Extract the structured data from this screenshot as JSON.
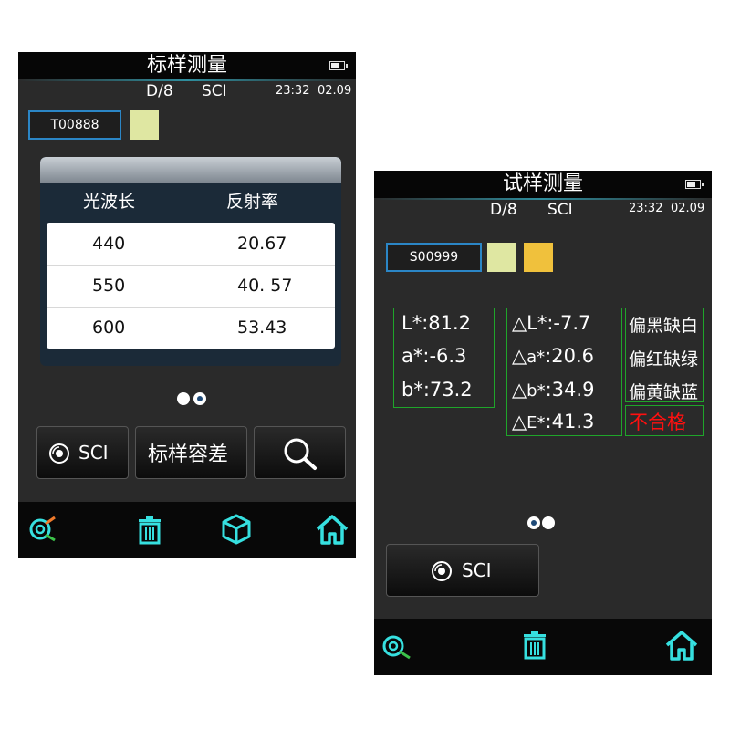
{
  "screen1": {
    "title": "标样测量",
    "geometry": "D/8",
    "mode": "SCI",
    "time": "23:32",
    "date": "02.09",
    "sample_id": "T00888",
    "swatch_color": "#dfe7a2",
    "table": {
      "headers": [
        "光波长",
        "反射率"
      ],
      "rows": [
        {
          "wavelength": "440",
          "reflectance": "20.67"
        },
        {
          "wavelength": "550",
          "reflectance": "40. 57"
        },
        {
          "wavelength": "600",
          "reflectance": "53.43"
        }
      ]
    },
    "buttons": {
      "sci": "SCI",
      "tolerance": "标样容差"
    },
    "icons": [
      "target-icon",
      "trash-icon",
      "cube-icon",
      "home-icon"
    ]
  },
  "screen2": {
    "title": "试样测量",
    "geometry": "D/8",
    "mode": "SCI",
    "time": "23:32",
    "date": "02.09",
    "sample_id": "S00999",
    "swatch_colors": [
      "#dfe7a2",
      "#f0c13c"
    ],
    "lab": [
      "L*:81.2",
      "a*:-6.3",
      "b*:73.2"
    ],
    "delta": {
      "dL": {
        "sym": "△",
        "name": "L*",
        "val": ":-7.7"
      },
      "da": {
        "sym": "△",
        "name": "a*",
        "val": ":20.6"
      },
      "db": {
        "sym": "△",
        "name": "b*",
        "val": ":34.9"
      },
      "dE": {
        "sym": "△",
        "name": "E*",
        "val": ":41.3"
      }
    },
    "deviations": [
      "偏黑缺白",
      "偏红缺绿",
      "偏黄缺蓝"
    ],
    "result": "不合格",
    "buttons": {
      "sci": "SCI"
    },
    "icons": [
      "target-icon",
      "trash-icon",
      "home-icon"
    ]
  },
  "colors": {
    "accent_teal": "#36e0e0",
    "border_green": "#1fa52a",
    "fail_red": "#ff1010",
    "sample_border_blue": "#2b86c6"
  }
}
